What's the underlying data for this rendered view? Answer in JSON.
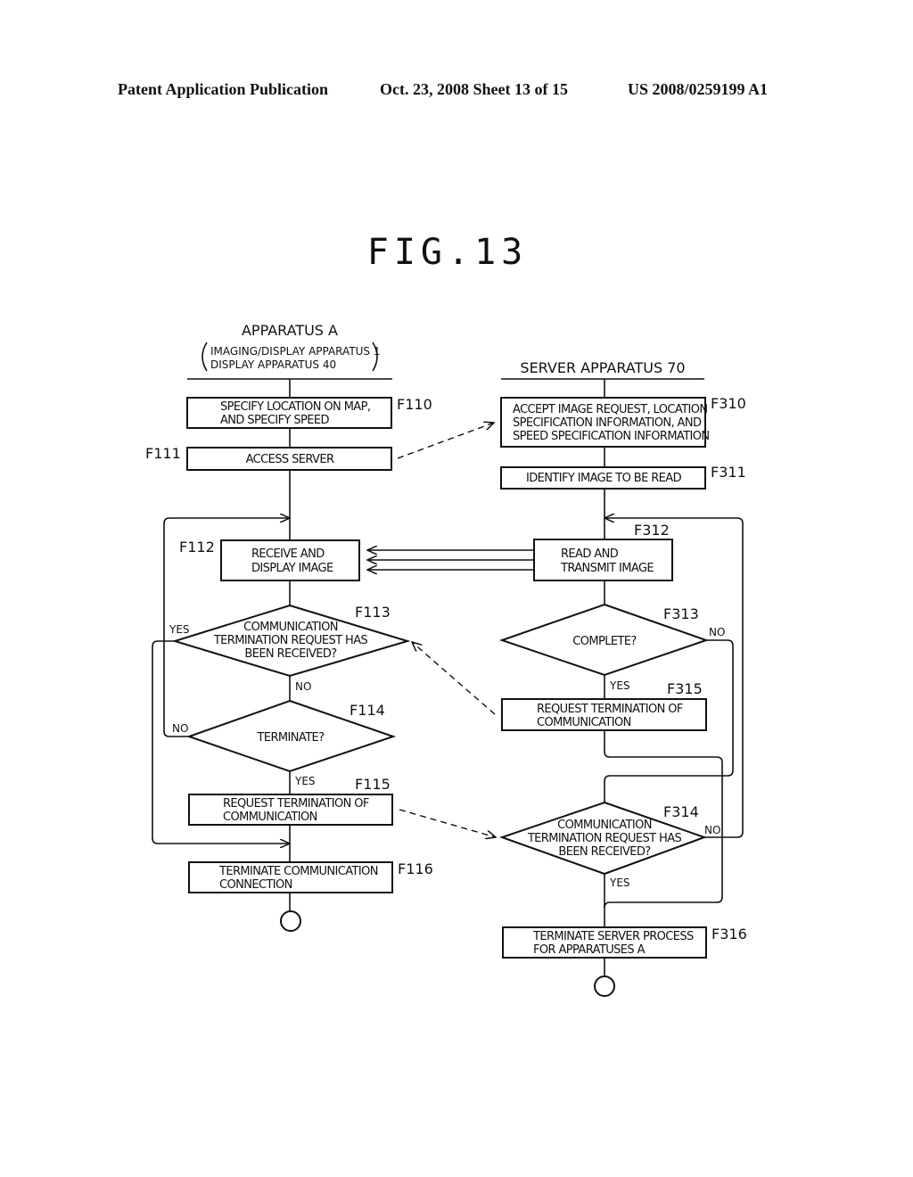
{
  "header": {
    "publication": "Patent Application Publication",
    "date_sheet": "Oct. 23, 2008   Sheet 13 of 15",
    "number": "US 2008/0259199 A1"
  },
  "figure_title": "FIG.13",
  "columns": {
    "left": {
      "title": "APPARATUS A",
      "subtitle_lines": [
        "IMAGING/DISPLAY APPARATUS 1",
        "DISPLAY APPARATUS 40"
      ]
    },
    "right": {
      "title": "SERVER APPARATUS 70"
    }
  },
  "steps": {
    "F110": {
      "id": "F110",
      "lines": [
        "SPECIFY LOCATION ON MAP,",
        "AND SPECIFY SPEED"
      ]
    },
    "F111": {
      "id": "F111",
      "lines": [
        "ACCESS SERVER"
      ]
    },
    "F112": {
      "id": "F112",
      "lines": [
        "RECEIVE AND",
        "DISPLAY IMAGE"
      ]
    },
    "F113": {
      "id": "F113",
      "lines": [
        "COMMUNICATION",
        "TERMINATION REQUEST HAS",
        "BEEN RECEIVED?"
      ]
    },
    "F114": {
      "id": "F114",
      "lines": [
        "TERMINATE?"
      ]
    },
    "F115": {
      "id": "F115",
      "lines": [
        "REQUEST TERMINATION OF",
        "COMMUNICATION"
      ]
    },
    "F116": {
      "id": "F116",
      "lines": [
        "TERMINATE COMMUNICATION",
        "CONNECTION"
      ]
    },
    "F310": {
      "id": "F310",
      "lines": [
        "ACCEPT IMAGE REQUEST, LOCATION",
        "SPECIFICATION INFORMATION, AND",
        "SPEED SPECIFICATION INFORMATION"
      ]
    },
    "F311": {
      "id": "F311",
      "lines": [
        "IDENTIFY IMAGE TO BE READ"
      ]
    },
    "F312": {
      "id": "F312",
      "lines": [
        "READ AND",
        "TRANSMIT IMAGE"
      ]
    },
    "F313": {
      "id": "F313",
      "lines": [
        "COMPLETE?"
      ]
    },
    "F314": {
      "id": "F314",
      "lines": [
        "COMMUNICATION",
        "TERMINATION REQUEST HAS",
        "BEEN RECEIVED?"
      ]
    },
    "F315": {
      "id": "F315",
      "lines": [
        "REQUEST TERMINATION OF",
        "COMMUNICATION"
      ]
    },
    "F316": {
      "id": "F316",
      "lines": [
        "TERMINATE SERVER PROCESS",
        "FOR APPARATUSES A"
      ]
    }
  },
  "branch_labels": {
    "yes": "YES",
    "no": "NO"
  }
}
